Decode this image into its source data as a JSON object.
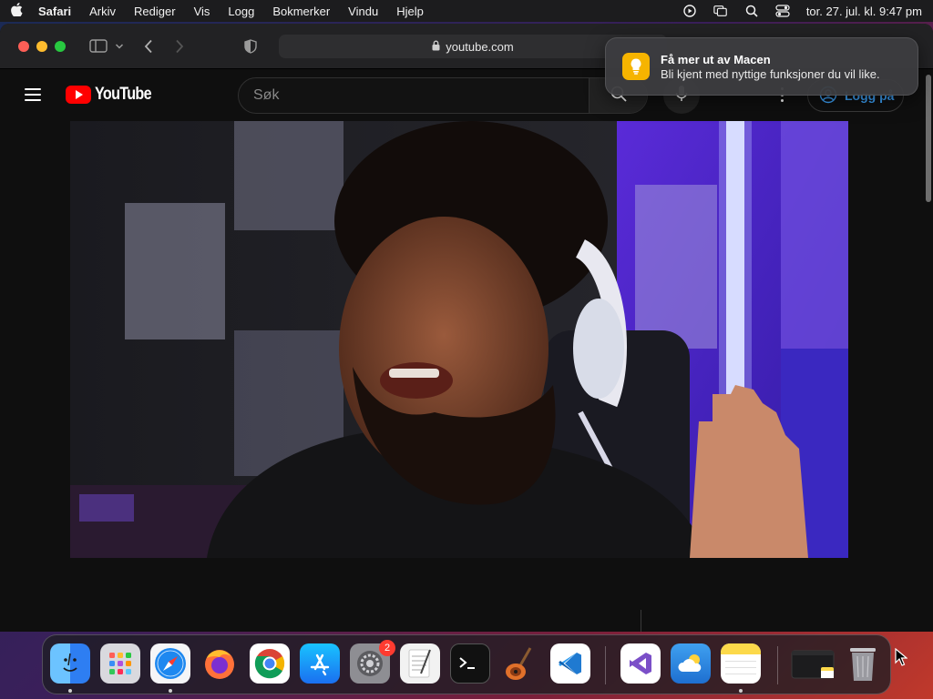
{
  "menubar": {
    "app_name": "Safari",
    "items": [
      "Arkiv",
      "Rediger",
      "Vis",
      "Logg",
      "Bokmerker",
      "Vindu",
      "Hjelp"
    ],
    "clock": "tor. 27. jul. kl. 9:47 pm"
  },
  "safari": {
    "address": "youtube.com"
  },
  "youtube": {
    "logo_text": "YouTube",
    "search_placeholder": "Søk",
    "signin_label": "Logg på"
  },
  "notification": {
    "title": "Få mer ut av Macen",
    "body": "Bli kjent med nyttige funksjoner du vil like."
  },
  "dock": {
    "apps": [
      {
        "name": "Finder",
        "icon": "finder-icon",
        "color": "#3a8ef6",
        "running": true
      },
      {
        "name": "Launchpad",
        "icon": "launchpad-icon",
        "color": "#e5e5ea",
        "running": false
      },
      {
        "name": "Safari",
        "icon": "safari-icon",
        "color": "#1e88f0",
        "running": true
      },
      {
        "name": "Firefox",
        "icon": "firefox-icon",
        "color": "#ff7139",
        "running": false
      },
      {
        "name": "Chrome",
        "icon": "chrome-icon",
        "color": "#ffffff",
        "running": false
      },
      {
        "name": "App Store",
        "icon": "app-store-icon",
        "color": "#1e9cf0",
        "running": false
      },
      {
        "name": "System Settings",
        "icon": "system-settings-icon",
        "color": "#8e8e93",
        "running": false,
        "badge": "2"
      },
      {
        "name": "TextEdit",
        "icon": "textedit-icon",
        "color": "#f2f2f2",
        "running": false
      },
      {
        "name": "Terminal",
        "icon": "terminal-icon",
        "color": "#111111",
        "running": false
      },
      {
        "name": "GarageBand",
        "icon": "garageband-icon",
        "color": "#2b2b2b",
        "running": false
      },
      {
        "name": "Visual Studio Code",
        "icon": "vscode-icon",
        "color": "#ffffff",
        "running": false
      },
      {
        "name": "Visual Studio",
        "icon": "visual-studio-icon",
        "color": "#ffffff",
        "running": false
      },
      {
        "name": "Weather",
        "icon": "weather-icon",
        "color": "#2f86de",
        "running": false
      },
      {
        "name": "Notes",
        "icon": "notes-icon",
        "color": "#fcd94a",
        "running": true
      }
    ]
  }
}
